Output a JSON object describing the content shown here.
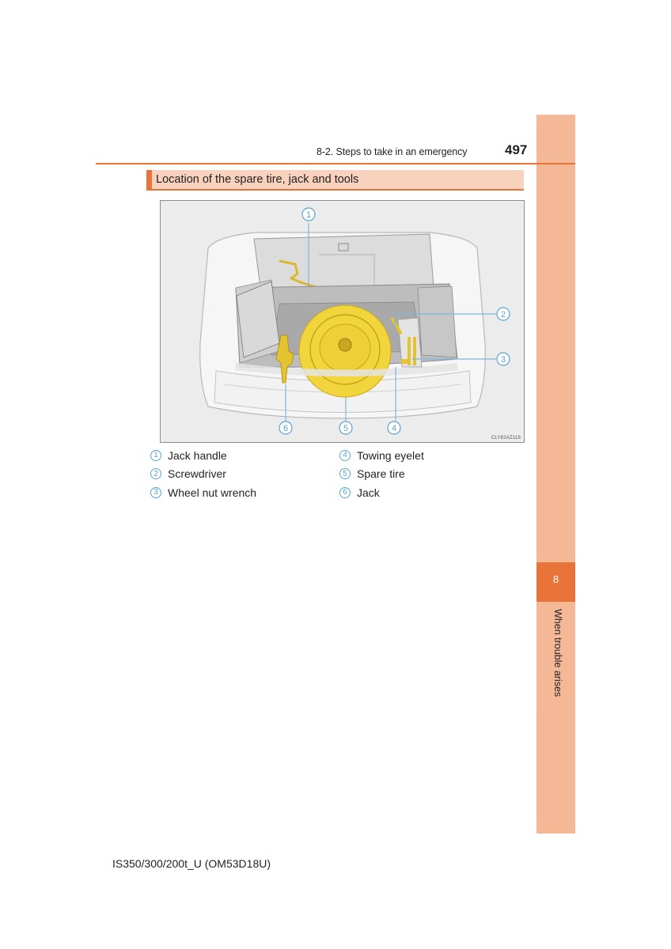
{
  "header": {
    "section": "8-2. Steps to take in an emergency",
    "page_number": "497"
  },
  "side_tab": {
    "chapter_number": "8",
    "chapter_title": "When trouble arises",
    "colors": {
      "tab": "#f4b896",
      "chapter": "#e8743a"
    }
  },
  "section": {
    "title": "Location of the spare tire, jack and tools",
    "accent": "#e8743a",
    "background": "#f8d2bd"
  },
  "figure": {
    "code": "CLY82AZ118",
    "callouts": [
      "1",
      "2",
      "3",
      "4",
      "5",
      "6"
    ],
    "callout_color": "#5ba4cf",
    "highlight_color": "#f2d53c"
  },
  "legend": {
    "left": [
      {
        "num": "1",
        "label": "Jack handle"
      },
      {
        "num": "2",
        "label": "Screwdriver"
      },
      {
        "num": "3",
        "label": "Wheel nut wrench"
      }
    ],
    "right": [
      {
        "num": "4",
        "label": "Towing eyelet"
      },
      {
        "num": "5",
        "label": "Spare tire"
      },
      {
        "num": "6",
        "label": "Jack"
      }
    ]
  },
  "footer": {
    "model": "IS350/300/200t_U (OM53D18U)"
  }
}
